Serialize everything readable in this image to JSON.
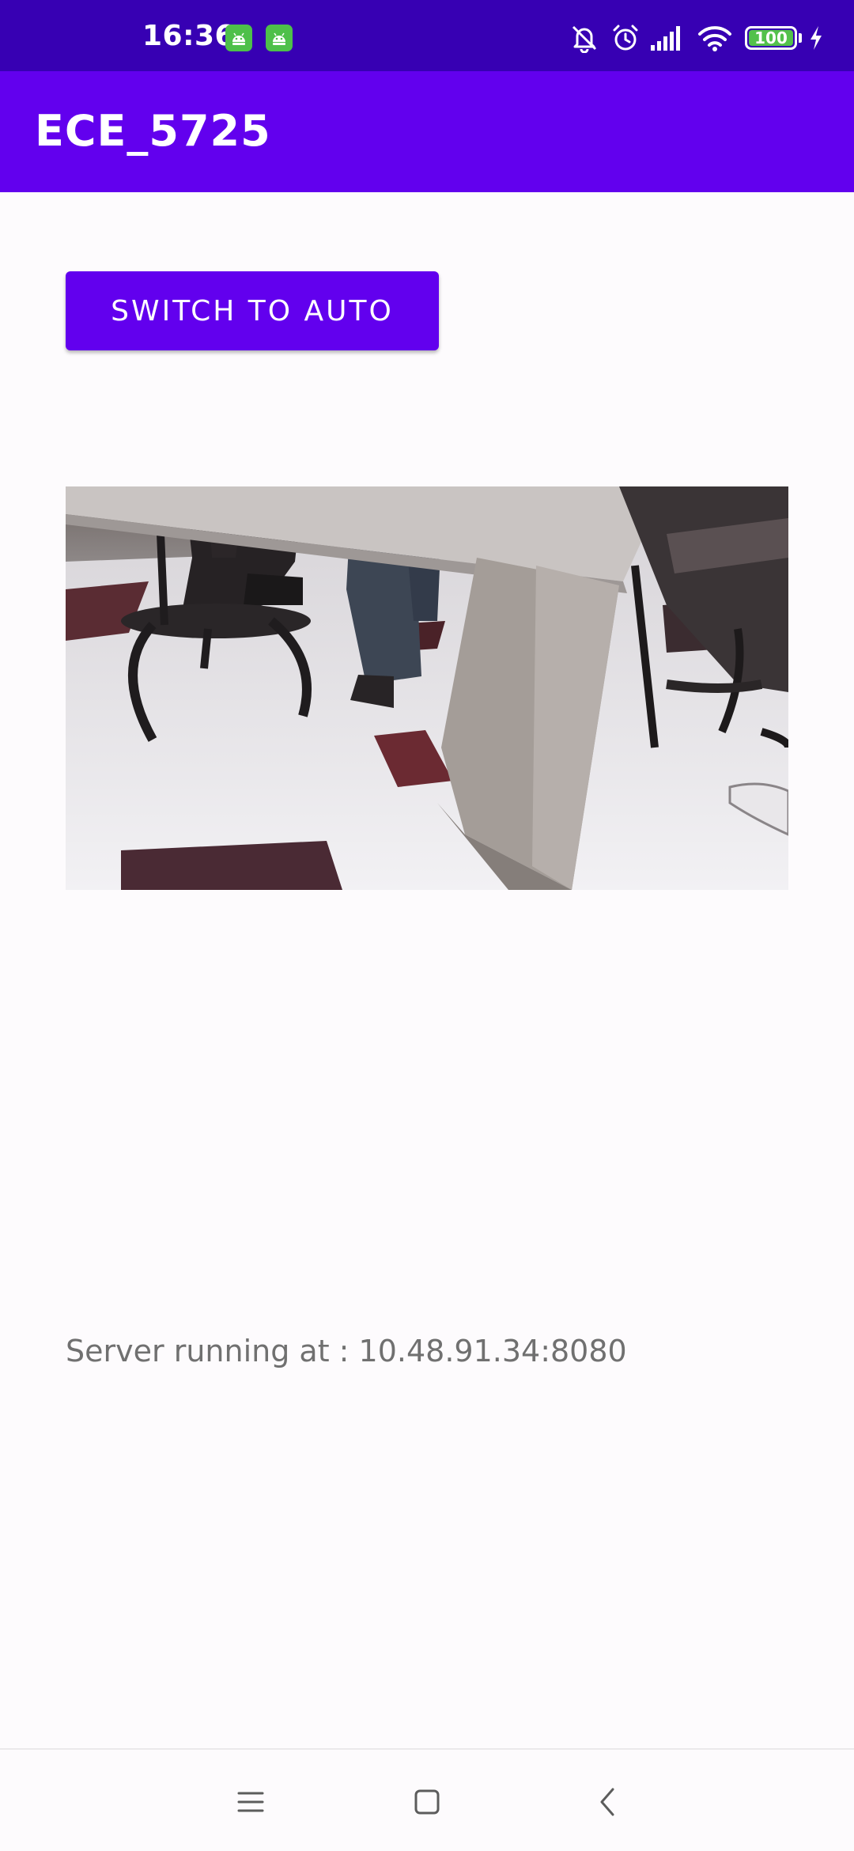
{
  "status_bar": {
    "time": "16:36",
    "battery_text": "100",
    "battery_level": 1.0,
    "icons": [
      "android-badge-icon",
      "android-badge-icon",
      "bell-muted-icon",
      "alarm-icon",
      "cellular-signal-icon",
      "wifi-icon",
      "battery-icon",
      "charging-bolt-icon"
    ]
  },
  "app_bar": {
    "title": "ECE_5725"
  },
  "main": {
    "mode_button_label": "SWITCH TO AUTO",
    "server_status": "Server running at : 10.48.91.34:8080"
  },
  "nav_bar": {
    "icons": [
      "menu-icon",
      "home-icon",
      "back-icon"
    ]
  },
  "colors": {
    "status_bar": "#3700b3",
    "app_bar": "#6200ee",
    "button": "#6200ee",
    "background": "#fdfbfd",
    "server_text": "#707070",
    "battery_fill": "#53c14b"
  }
}
